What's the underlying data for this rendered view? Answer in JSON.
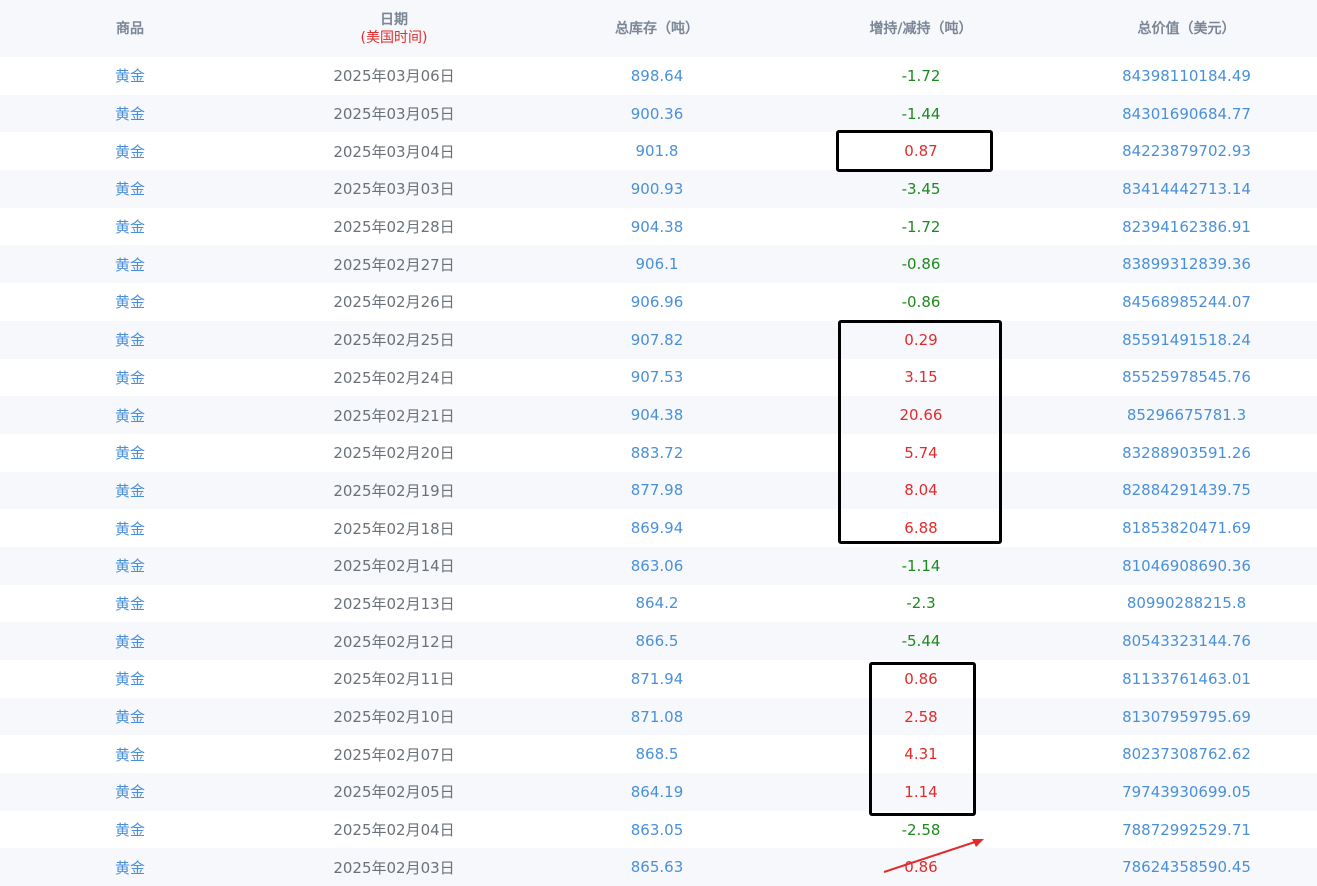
{
  "headers": {
    "commodity": "商品",
    "date": "日期",
    "date_sub": "(美国时间)",
    "total": "总库存（吨）",
    "change": "增持/减持（吨）",
    "value": "总价值（美元）"
  },
  "rows": [
    {
      "commodity": "黄金",
      "date": "2025年03月06日",
      "total": "898.64",
      "change": "-1.72",
      "value": "84398110184.49",
      "dir": "down"
    },
    {
      "commodity": "黄金",
      "date": "2025年03月05日",
      "total": "900.36",
      "change": "-1.44",
      "value": "84301690684.77",
      "dir": "down"
    },
    {
      "commodity": "黄金",
      "date": "2025年03月04日",
      "total": "901.8",
      "change": "0.87",
      "value": "84223879702.93",
      "dir": "up"
    },
    {
      "commodity": "黄金",
      "date": "2025年03月03日",
      "total": "900.93",
      "change": "-3.45",
      "value": "83414442713.14",
      "dir": "down"
    },
    {
      "commodity": "黄金",
      "date": "2025年02月28日",
      "total": "904.38",
      "change": "-1.72",
      "value": "82394162386.91",
      "dir": "down"
    },
    {
      "commodity": "黄金",
      "date": "2025年02月27日",
      "total": "906.1",
      "change": "-0.86",
      "value": "83899312839.36",
      "dir": "down"
    },
    {
      "commodity": "黄金",
      "date": "2025年02月26日",
      "total": "906.96",
      "change": "-0.86",
      "value": "84568985244.07",
      "dir": "down"
    },
    {
      "commodity": "黄金",
      "date": "2025年02月25日",
      "total": "907.82",
      "change": "0.29",
      "value": "85591491518.24",
      "dir": "up"
    },
    {
      "commodity": "黄金",
      "date": "2025年02月24日",
      "total": "907.53",
      "change": "3.15",
      "value": "85525978545.76",
      "dir": "up"
    },
    {
      "commodity": "黄金",
      "date": "2025年02月21日",
      "total": "904.38",
      "change": "20.66",
      "value": "85296675781.3",
      "dir": "up"
    },
    {
      "commodity": "黄金",
      "date": "2025年02月20日",
      "total": "883.72",
      "change": "5.74",
      "value": "83288903591.26",
      "dir": "up"
    },
    {
      "commodity": "黄金",
      "date": "2025年02月19日",
      "total": "877.98",
      "change": "8.04",
      "value": "82884291439.75",
      "dir": "up"
    },
    {
      "commodity": "黄金",
      "date": "2025年02月18日",
      "total": "869.94",
      "change": "6.88",
      "value": "81853820471.69",
      "dir": "up"
    },
    {
      "commodity": "黄金",
      "date": "2025年02月14日",
      "total": "863.06",
      "change": "-1.14",
      "value": "81046908690.36",
      "dir": "down"
    },
    {
      "commodity": "黄金",
      "date": "2025年02月13日",
      "total": "864.2",
      "change": "-2.3",
      "value": "80990288215.8",
      "dir": "down"
    },
    {
      "commodity": "黄金",
      "date": "2025年02月12日",
      "total": "866.5",
      "change": "-5.44",
      "value": "80543323144.76",
      "dir": "down"
    },
    {
      "commodity": "黄金",
      "date": "2025年02月11日",
      "total": "871.94",
      "change": "0.86",
      "value": "81133761463.01",
      "dir": "up"
    },
    {
      "commodity": "黄金",
      "date": "2025年02月10日",
      "total": "871.08",
      "change": "2.58",
      "value": "81307959795.69",
      "dir": "up"
    },
    {
      "commodity": "黄金",
      "date": "2025年02月07日",
      "total": "868.5",
      "change": "4.31",
      "value": "80237308762.62",
      "dir": "up"
    },
    {
      "commodity": "黄金",
      "date": "2025年02月05日",
      "total": "864.19",
      "change": "1.14",
      "value": "79743930699.05",
      "dir": "up"
    },
    {
      "commodity": "黄金",
      "date": "2025年02月04日",
      "total": "863.05",
      "change": "-2.58",
      "value": "78872992529.71",
      "dir": "down"
    },
    {
      "commodity": "黄金",
      "date": "2025年02月03日",
      "total": "865.63",
      "change": "0.86",
      "value": "78624358590.45",
      "dir": "up"
    }
  ],
  "colors": {
    "link": "#4a90d9",
    "positive": "#e22b2b",
    "negative": "#1e8a1e",
    "annotation_box": "#000000",
    "annotation_arrow": "#e22b2b"
  }
}
